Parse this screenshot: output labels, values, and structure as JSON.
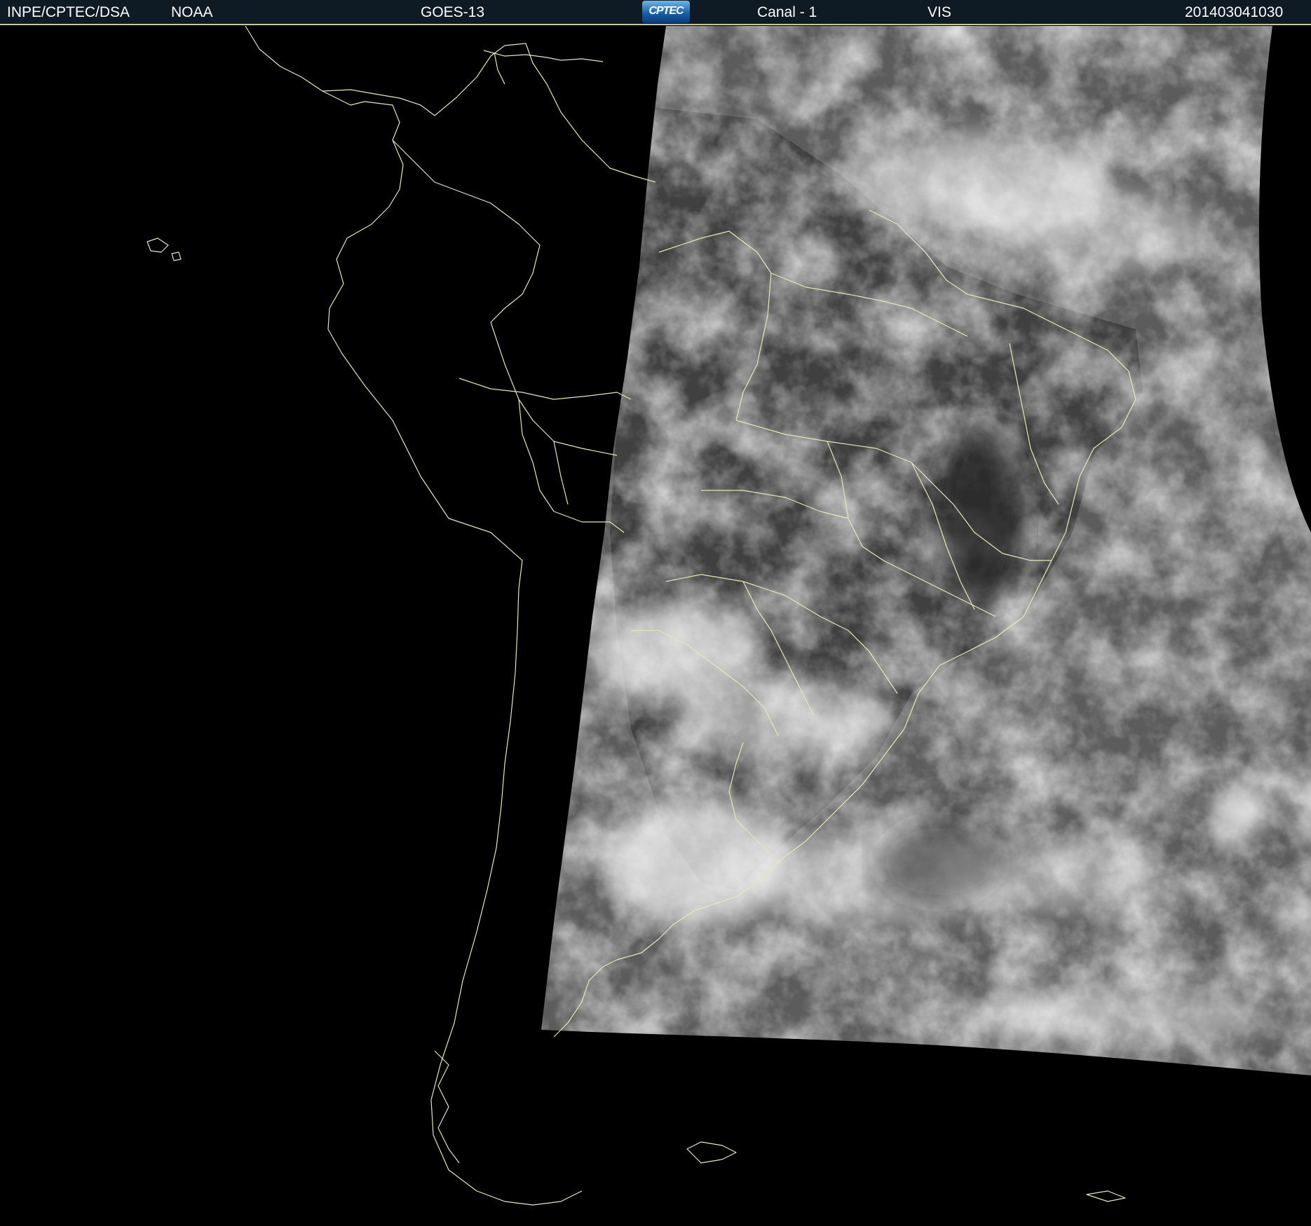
{
  "header": {
    "organization": "INPE/CPTEC/DSA",
    "agency": "NOAA",
    "satellite": "GOES-13",
    "logo_text": "CPTEC",
    "channel": "Canal - 1",
    "band": "VIS",
    "timestamp": "201403041030"
  },
  "colors": {
    "background": "#000000",
    "header_bg": "#0f1b24",
    "coastline": "#e6e6b4",
    "cloud_bright": "#f2f2f2",
    "ocean_gray": "#6e6e6e"
  }
}
